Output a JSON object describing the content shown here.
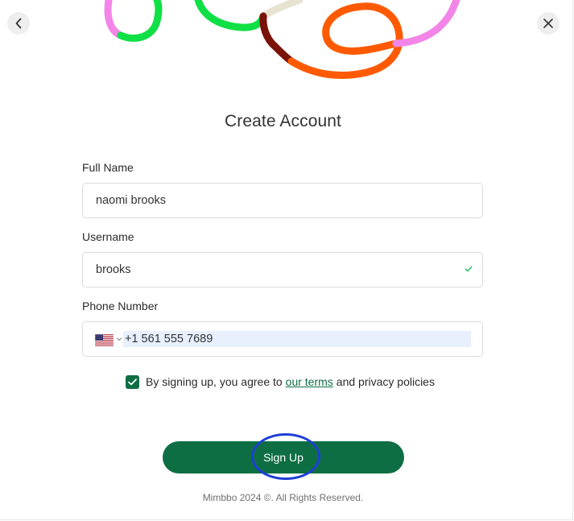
{
  "header": {
    "back_icon": "chevron-left-icon",
    "close_icon": "close-icon"
  },
  "form": {
    "title": "Create Account",
    "full_name": {
      "label": "Full Name",
      "value": "naomi brooks"
    },
    "username": {
      "label": "Username",
      "value": "brooks",
      "valid": true
    },
    "phone": {
      "label": "Phone Number",
      "country": "US",
      "value": "+1 561 555 7689"
    },
    "agreement": {
      "checked": true,
      "prefix": "By signing up, you agree to",
      "link_text": "our terms",
      "suffix": "and privacy policies"
    },
    "submit_label": "Sign Up"
  },
  "footer": {
    "copyright": "Mimbbo 2024 ©. All Rights Reserved."
  },
  "colors": {
    "primary": "#0e6e43",
    "highlight_ring": "#1e3fd6",
    "autofill_bg": "#e8f0fe",
    "deco_pink": "#f385e8",
    "deco_green": "#10e045",
    "deco_maroon": "#7a1208",
    "deco_orange": "#ff5a00",
    "deco_beige": "#e7e3d3"
  }
}
